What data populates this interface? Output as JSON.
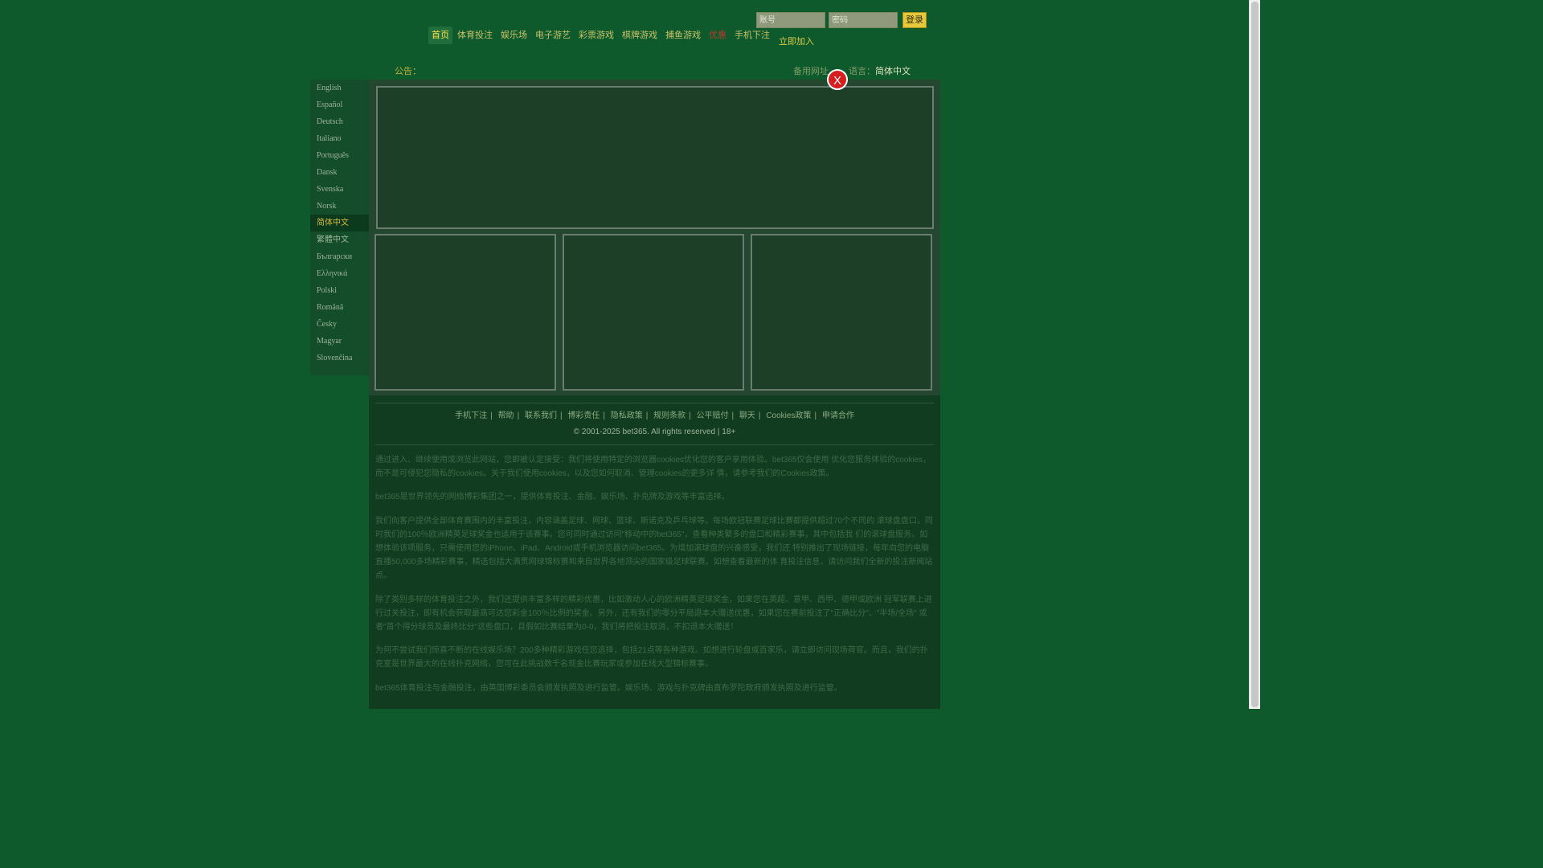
{
  "nav": {
    "items": [
      "首页",
      "体育投注",
      "娱乐场",
      "电子游艺",
      "彩票游戏",
      "棋牌游戏",
      "捕鱼游戏",
      "优惠",
      "手机下注"
    ],
    "active_index": 0,
    "hot_index": 7
  },
  "login": {
    "username_placeholder": "账号",
    "password_placeholder": "密码",
    "login_button": "登录",
    "join_link": "立即加入"
  },
  "notice": {
    "label": "公告："
  },
  "backup_site": "备用网址",
  "language": {
    "label": "语言：",
    "value": "简体中文"
  },
  "sidebar": {
    "languages": [
      "English",
      "Español",
      "Deutsch",
      "Italiano",
      "Português",
      "Dansk",
      "Svenska",
      "Norsk",
      "简体中文",
      "繁體中文",
      "Български",
      "Ελληνικά",
      "Polski",
      "Română",
      "Česky",
      "Magyar",
      "Slovenčina"
    ],
    "selected": "简体中文"
  },
  "popup": {
    "close_label": "X"
  },
  "footer": {
    "links": [
      "手机下注",
      "帮助",
      "联系我们",
      "博彩责任",
      "隐私政策",
      "规则条款",
      "公平赔付",
      "聊天",
      "Cookies政策",
      "申请合作"
    ],
    "copyright": "© 2001-2025 bet365. All rights reserved | 18+"
  },
  "paragraphs": [
    "通过进入、继续使用或浏览此网站，您即被认定接受：我们将使用特定的浏览器cookies优化您的客户享用体验。bet365仅会使用 优化您服务体验的cookies，而不是可侵犯您隐私的cookies。关于我们使用cookies，以及您如何取消、管理cookies的更多详 情，请参考我们的Cookies政策。",
    "bet365是世界领先的网络博彩集团之一，提供体育投注、金融、娱乐场、扑克牌及游戏等丰富选择。",
    "我们向客户提供全部体育赛围内的丰富投注，内容涵盖足球、网球、篮球、斯诺克及乒乓球等。每场欧冠联赛足球比赛都提供超过70个不同的 滚球盘盘口，同时我们的100％欧洲精英足球奖金也适用于该赛事。您可同时通过访问\"移动中的bet365\"，查看种类繁多的盘口和精彩赛事，其中包括我 们的滚球盘服务。如想体验该项服务，只需使用您的iPhone、iPad、Android或手机浏览器访问bet365。为增加滚球盘的兴奋感受，我们还 特别推出了现场链接，每年向您的电脑直播50,000多场精彩赛事，精选包括大满贯网球锦标赛和来自世界各地顶尖的国家级足球联赛。如想查看最新的体 育投注信息，请访问我们全新的投注新闻站点。",
    "除了类别多样的体育投注之外，我们还提供丰富多样的精彩优惠，比如激动人心的欧洲精英足球奖金，如果您在英超、意甲、西甲、德甲或欧洲 冠军联赛上进行过关投注，即有机会获取最高可达您彩金100％比例的奖金。另外，还有我们的零分平局退本大赠送优惠，如果您在赛前投注了\"正确比分\"、\"半场/全场\" 或者\"首个得分球员及最终比分\"这些盘口，且假如比赛结果为0-0，我们将把投注取消，不扣退本大赠送！",
    "为何不尝试我们惊喜不断的在线娱乐场？200多种精彩游戏任您选择，包括21点等各种游戏。如想进行轮盘或百家乐，请立即访问现场荷官。而且，我们的扑克室是世界最大的在线扑克网络，您可在此挑战数千名现金比赛玩家或参加在线大型锦标赛事。",
    "bet365体育投注与金融投注，由英国博彩委员会颁发执照及进行监管。娱乐场、游戏与扑克牌由直布罗陀政府颁发执照及进行监管。"
  ]
}
